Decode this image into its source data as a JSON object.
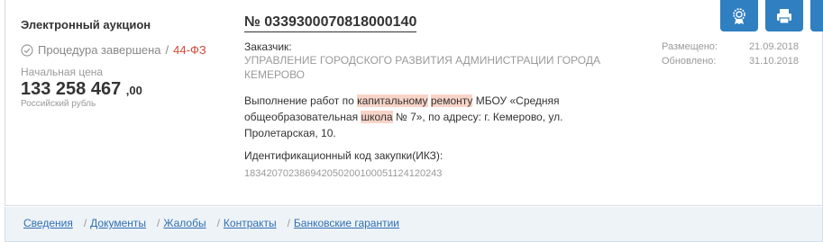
{
  "procedure": {
    "type": "Электронный аукцион",
    "status": "Процедура завершена",
    "law_separator": "/",
    "law": "44-ФЗ",
    "price_label": "Начальная цена",
    "price_int": "133 258 467",
    "price_cents": ",00",
    "currency": "Российский рубль"
  },
  "purchase": {
    "number": "№ 0339300070818000140",
    "customer_label": "Заказчик:",
    "customer_name": "УПРАВЛЕНИЕ ГОРОДСКОГО РАЗВИТИЯ АДМИНИСТРАЦИИ ГОРОДА КЕМЕРОВО",
    "subject_parts": {
      "p1": "Выполнение работ по ",
      "h1": "капитальному",
      "p2": " ",
      "h2": "ремонту",
      "p3": " МБОУ «Средняя общеобразовательная ",
      "h3": "школа",
      "p4": " № 7», по адресу: г. Кемерово, ул. Пролетарская, 10."
    },
    "ikz_label": "Идентификационный код закупки(ИКЗ):",
    "ikz": "183420702386942050200100051124120243"
  },
  "dates": {
    "placed_label": "Размещено:",
    "placed": "21.09.2018",
    "updated_label": "Обновлено:",
    "updated": "31.10.2018"
  },
  "actions": [
    {
      "icon": "award-ribbon-icon"
    },
    {
      "icon": "printer-icon"
    },
    {
      "icon": "shield-check-icon"
    }
  ],
  "colors": {
    "accent": "#2f7fc1",
    "law": "#d04a3a",
    "highlight": "#f8d4c8",
    "link": "#2f6fb3"
  },
  "tabs": {
    "t1": "Сведения",
    "t2": "Документы",
    "t3": "Жалобы",
    "t4": "Контракты",
    "t5": "Банковские гарантии",
    "separator": "/"
  }
}
